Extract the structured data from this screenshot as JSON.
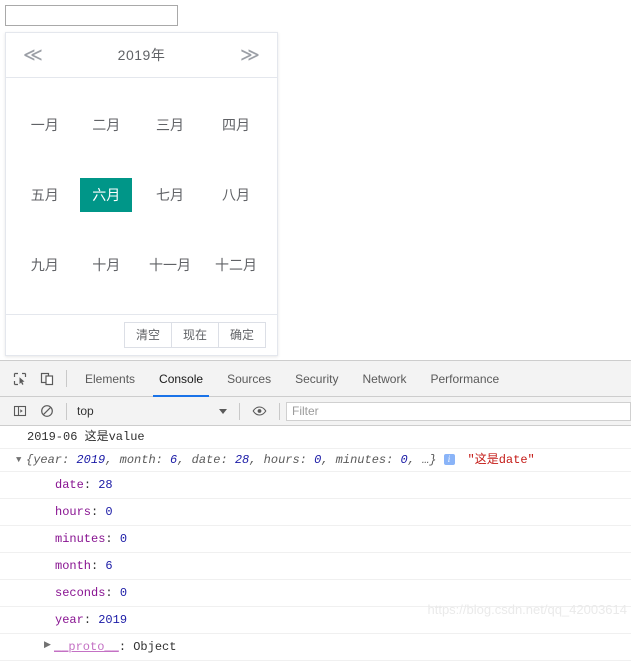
{
  "date_input": {
    "value": "",
    "placeholder": ""
  },
  "picker": {
    "prev_icon": "double-chevron-left-icon",
    "next_icon": "double-chevron-right-icon",
    "prev_glyph": "≪",
    "next_glyph": "≫",
    "title": "2019年",
    "months": [
      {
        "label": "一月",
        "selected": false
      },
      {
        "label": "二月",
        "selected": false
      },
      {
        "label": "三月",
        "selected": false
      },
      {
        "label": "四月",
        "selected": false
      },
      {
        "label": "五月",
        "selected": false
      },
      {
        "label": "六月",
        "selected": true
      },
      {
        "label": "七月",
        "selected": false
      },
      {
        "label": "八月",
        "selected": false
      },
      {
        "label": "九月",
        "selected": false
      },
      {
        "label": "十月",
        "selected": false
      },
      {
        "label": "十一月",
        "selected": false
      },
      {
        "label": "十二月",
        "selected": false
      }
    ],
    "selected_color": "#009688",
    "footer": {
      "clear": "清空",
      "now": "现在",
      "confirm": "确定"
    }
  },
  "devtools": {
    "inspect_icon": "inspect-element-icon",
    "device_icon": "device-toolbar-icon",
    "tabs": [
      {
        "label": "Elements",
        "active": false
      },
      {
        "label": "Console",
        "active": true
      },
      {
        "label": "Sources",
        "active": false
      },
      {
        "label": "Security",
        "active": false
      },
      {
        "label": "Network",
        "active": false
      },
      {
        "label": "Performance",
        "active": false
      }
    ],
    "active_tab_color": "#1a73e8",
    "filterbar": {
      "sidebar_icon": "console-sidebar-icon",
      "clear_icon": "clear-console-icon",
      "context": "top",
      "eye_icon": "live-expression-eye-icon",
      "filter_placeholder": "Filter",
      "filter_value": ""
    },
    "console": {
      "message1": "2019-06 这是value",
      "object_line": {
        "triangle": "▼",
        "preview_prefix": "{year: ",
        "year": "2019",
        "sep1": ", month: ",
        "month": "6",
        "sep2": ", date: ",
        "date": "28",
        "sep3": ", hours: ",
        "hours": "0",
        "sep4": ", minutes: ",
        "minutes": "0",
        "suffix": ", …}",
        "badge": "i",
        "trailing_string": "\"这是date\""
      },
      "properties": [
        {
          "key": "date",
          "value": "28"
        },
        {
          "key": "hours",
          "value": "0"
        },
        {
          "key": "minutes",
          "value": "0"
        },
        {
          "key": "month",
          "value": "6"
        },
        {
          "key": "seconds",
          "value": "0"
        },
        {
          "key": "year",
          "value": "2019"
        }
      ],
      "proto": {
        "triangle": "▶",
        "key": "__proto__",
        "value": ": Object"
      }
    }
  },
  "watermark": "https://blog.csdn.net/qq_42003614"
}
